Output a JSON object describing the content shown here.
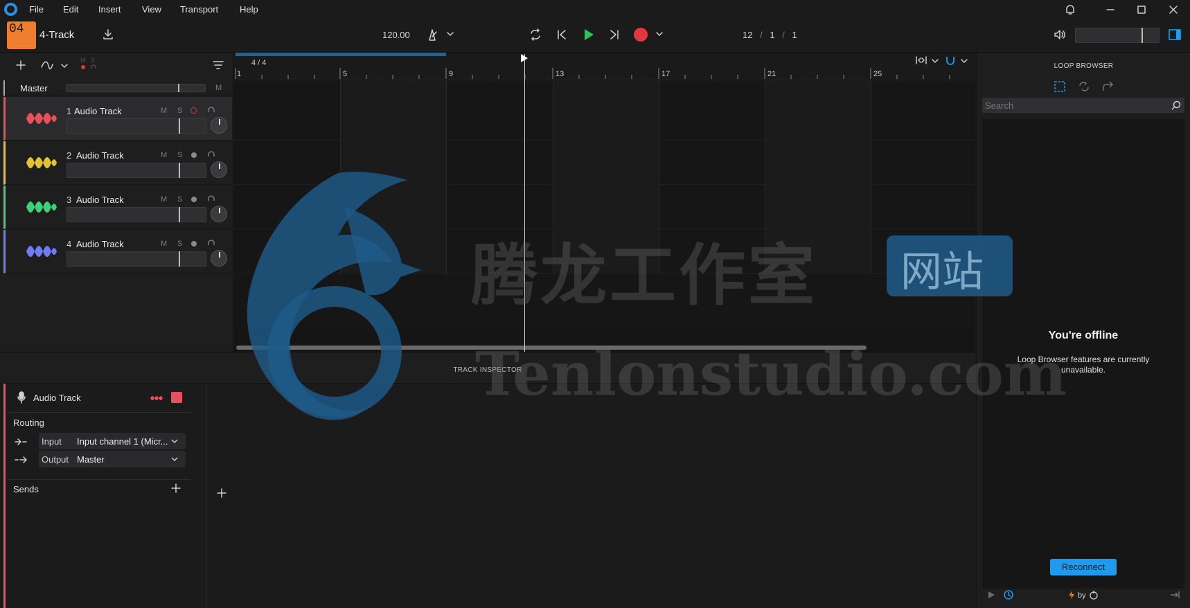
{
  "menu": {
    "items": [
      "File",
      "Edit",
      "Insert",
      "View",
      "Transport",
      "Help"
    ]
  },
  "project": {
    "badge": "04",
    "title": "4-Track"
  },
  "transport": {
    "tempo": "120.00",
    "position": [
      "12",
      "1",
      "1"
    ],
    "sep": "/"
  },
  "tracks": {
    "master_label": "Master",
    "master_m": "M",
    "ms_header": [
      "M",
      "S"
    ],
    "items": [
      {
        "num": "1",
        "name": "Audio Track",
        "m": "M",
        "s": "S",
        "color": "#e8505b"
      },
      {
        "num": "2",
        "name": "Audio Track",
        "m": "M",
        "s": "S",
        "color": "#e3c32f"
      },
      {
        "num": "3",
        "name": "Audio Track",
        "m": "M",
        "s": "S",
        "color": "#3fd07a"
      },
      {
        "num": "4",
        "name": "Audio Track",
        "m": "M",
        "s": "S",
        "color": "#6f7cf5"
      }
    ]
  },
  "timeline": {
    "time_signature": "4 / 4",
    "bars": [
      "1",
      "5",
      "9",
      "13",
      "17",
      "21",
      "25"
    ]
  },
  "inspector": {
    "header": "TRACK INSPECTOR",
    "track_name": "Audio Track",
    "routing_label": "Routing",
    "input_label": "Input",
    "input_value": "Input channel 1 (Micr...",
    "output_label": "Output",
    "output_value": "Master",
    "sends_label": "Sends"
  },
  "loop_browser": {
    "title": "LOOP BROWSER",
    "search_placeholder": "Search",
    "offline_title": "You're offline",
    "offline_text": "Loop Browser features are currently unavailable.",
    "reconnect_label": "Reconnect",
    "footer_by": "by"
  },
  "watermark": {
    "cn": "腾龙工作室",
    "badge": "网站",
    "en": "Tenlonstudio.com"
  },
  "colors": {
    "accent": "#1e9bf0",
    "record": "#e0383e",
    "play": "#2ec25a",
    "badge": "#ef7d2e"
  }
}
